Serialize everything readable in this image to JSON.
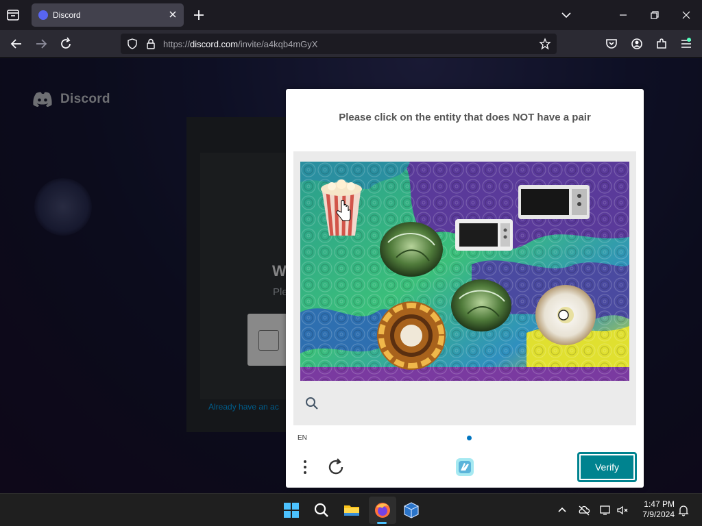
{
  "browser": {
    "tab_title": "Discord",
    "url_prefix": "https://",
    "url_host": "discord.com",
    "url_path": "/invite/a4kqb4mGyX"
  },
  "page": {
    "brand": "Discord",
    "heading_partial": "W",
    "subtext_partial": "Ple",
    "link_partial": "Already have an ac"
  },
  "captcha": {
    "prompt": "Please click on the entity that does NOT have a pair",
    "language": "EN",
    "verify_label": "Verify",
    "items": [
      "popcorn",
      "cabbage",
      "microwave",
      "donut",
      "cabbage",
      "microwave",
      "donut"
    ]
  },
  "taskbar": {
    "time": "1:47 PM",
    "date": "7/9/2024"
  },
  "colors": {
    "accent": "#00838f",
    "discord": "#5865f2",
    "browser_bg": "#1c1b22"
  }
}
